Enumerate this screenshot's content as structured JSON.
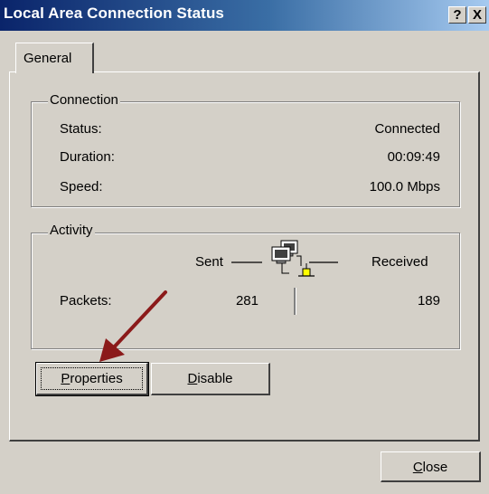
{
  "window": {
    "title": "Local Area Connection Status"
  },
  "titlebar": {
    "help_label": "?",
    "close_label": "X"
  },
  "tabs": [
    {
      "label": "General"
    }
  ],
  "connection": {
    "legend": "Connection",
    "rows": [
      {
        "label": "Status:",
        "value": "Connected"
      },
      {
        "label": "Duration:",
        "value": "00:09:49"
      },
      {
        "label": "Speed:",
        "value": "100.0 Mbps"
      }
    ]
  },
  "activity": {
    "legend": "Activity",
    "sent_label": "Sent",
    "received_label": "Received",
    "packets_label": "Packets:",
    "sent_value": "281",
    "received_value": "189"
  },
  "buttons": {
    "properties": "Properties",
    "disable": "Disable",
    "close": "Close"
  },
  "colors": {
    "titlebar_start": "#0a246a",
    "titlebar_end": "#a6caf0",
    "dialog_face": "#d4d0c8",
    "annotation_arrow": "#8b1a1a"
  },
  "icons": {
    "network": "network-computers-icon",
    "arrow": "annotation-arrow"
  }
}
